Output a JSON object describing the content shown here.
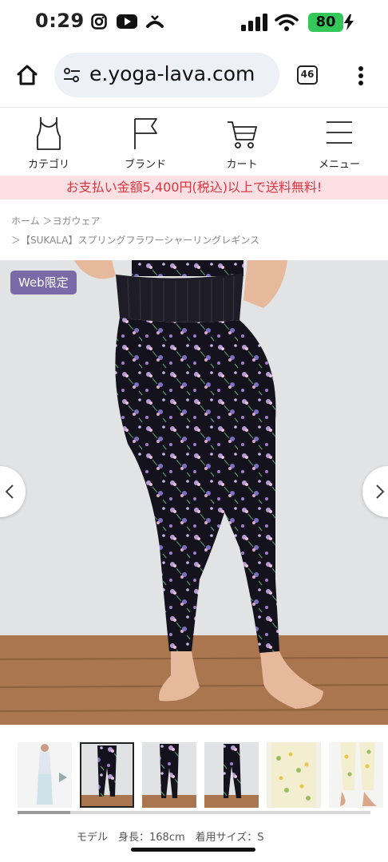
{
  "status_bar": {
    "time": "0:29",
    "battery": "80"
  },
  "browser": {
    "url": "e.yoga-lava.com",
    "tab_count": "46"
  },
  "site_nav": {
    "items": [
      {
        "label": "カテゴリ",
        "icon": "tanktop-icon"
      },
      {
        "label": "ブランド",
        "icon": "flag-icon"
      },
      {
        "label": "カート",
        "icon": "cart-icon"
      },
      {
        "label": "メニュー",
        "icon": "hamburger-icon"
      }
    ]
  },
  "banner": {
    "text": "お支払い金額5,400円(税込)以上で送料無料!"
  },
  "breadcrumb": {
    "line1": "ホーム ＞ヨガウェア",
    "line2": "＞【SUKALA】スプリングフラワーシャーリングレギンス"
  },
  "product": {
    "badge": "Web限定"
  },
  "caption": {
    "text": "モデル　身長：168cm　着用サイズ：S"
  },
  "colors": {
    "accent": "#7a6aa8",
    "banner_bg": "#fce0e3",
    "banner_text": "#d63a45",
    "battery": "#34c759"
  }
}
